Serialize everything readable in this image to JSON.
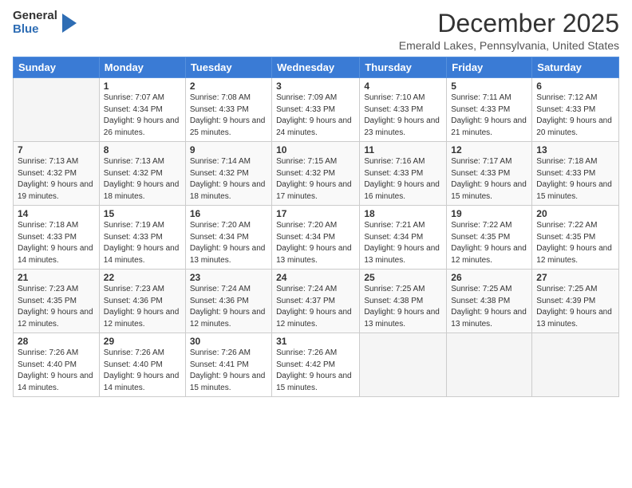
{
  "logo": {
    "general": "General",
    "blue": "Blue"
  },
  "title": "December 2025",
  "subtitle": "Emerald Lakes, Pennsylvania, United States",
  "days_of_week": [
    "Sunday",
    "Monday",
    "Tuesday",
    "Wednesday",
    "Thursday",
    "Friday",
    "Saturday"
  ],
  "weeks": [
    [
      {
        "num": "",
        "sunrise": "",
        "sunset": "",
        "daylight": ""
      },
      {
        "num": "1",
        "sunrise": "Sunrise: 7:07 AM",
        "sunset": "Sunset: 4:34 PM",
        "daylight": "Daylight: 9 hours and 26 minutes."
      },
      {
        "num": "2",
        "sunrise": "Sunrise: 7:08 AM",
        "sunset": "Sunset: 4:33 PM",
        "daylight": "Daylight: 9 hours and 25 minutes."
      },
      {
        "num": "3",
        "sunrise": "Sunrise: 7:09 AM",
        "sunset": "Sunset: 4:33 PM",
        "daylight": "Daylight: 9 hours and 24 minutes."
      },
      {
        "num": "4",
        "sunrise": "Sunrise: 7:10 AM",
        "sunset": "Sunset: 4:33 PM",
        "daylight": "Daylight: 9 hours and 23 minutes."
      },
      {
        "num": "5",
        "sunrise": "Sunrise: 7:11 AM",
        "sunset": "Sunset: 4:33 PM",
        "daylight": "Daylight: 9 hours and 21 minutes."
      },
      {
        "num": "6",
        "sunrise": "Sunrise: 7:12 AM",
        "sunset": "Sunset: 4:33 PM",
        "daylight": "Daylight: 9 hours and 20 minutes."
      }
    ],
    [
      {
        "num": "7",
        "sunrise": "Sunrise: 7:13 AM",
        "sunset": "Sunset: 4:32 PM",
        "daylight": "Daylight: 9 hours and 19 minutes."
      },
      {
        "num": "8",
        "sunrise": "Sunrise: 7:13 AM",
        "sunset": "Sunset: 4:32 PM",
        "daylight": "Daylight: 9 hours and 18 minutes."
      },
      {
        "num": "9",
        "sunrise": "Sunrise: 7:14 AM",
        "sunset": "Sunset: 4:32 PM",
        "daylight": "Daylight: 9 hours and 18 minutes."
      },
      {
        "num": "10",
        "sunrise": "Sunrise: 7:15 AM",
        "sunset": "Sunset: 4:32 PM",
        "daylight": "Daylight: 9 hours and 17 minutes."
      },
      {
        "num": "11",
        "sunrise": "Sunrise: 7:16 AM",
        "sunset": "Sunset: 4:33 PM",
        "daylight": "Daylight: 9 hours and 16 minutes."
      },
      {
        "num": "12",
        "sunrise": "Sunrise: 7:17 AM",
        "sunset": "Sunset: 4:33 PM",
        "daylight": "Daylight: 9 hours and 15 minutes."
      },
      {
        "num": "13",
        "sunrise": "Sunrise: 7:18 AM",
        "sunset": "Sunset: 4:33 PM",
        "daylight": "Daylight: 9 hours and 15 minutes."
      }
    ],
    [
      {
        "num": "14",
        "sunrise": "Sunrise: 7:18 AM",
        "sunset": "Sunset: 4:33 PM",
        "daylight": "Daylight: 9 hours and 14 minutes."
      },
      {
        "num": "15",
        "sunrise": "Sunrise: 7:19 AM",
        "sunset": "Sunset: 4:33 PM",
        "daylight": "Daylight: 9 hours and 14 minutes."
      },
      {
        "num": "16",
        "sunrise": "Sunrise: 7:20 AM",
        "sunset": "Sunset: 4:34 PM",
        "daylight": "Daylight: 9 hours and 13 minutes."
      },
      {
        "num": "17",
        "sunrise": "Sunrise: 7:20 AM",
        "sunset": "Sunset: 4:34 PM",
        "daylight": "Daylight: 9 hours and 13 minutes."
      },
      {
        "num": "18",
        "sunrise": "Sunrise: 7:21 AM",
        "sunset": "Sunset: 4:34 PM",
        "daylight": "Daylight: 9 hours and 13 minutes."
      },
      {
        "num": "19",
        "sunrise": "Sunrise: 7:22 AM",
        "sunset": "Sunset: 4:35 PM",
        "daylight": "Daylight: 9 hours and 12 minutes."
      },
      {
        "num": "20",
        "sunrise": "Sunrise: 7:22 AM",
        "sunset": "Sunset: 4:35 PM",
        "daylight": "Daylight: 9 hours and 12 minutes."
      }
    ],
    [
      {
        "num": "21",
        "sunrise": "Sunrise: 7:23 AM",
        "sunset": "Sunset: 4:35 PM",
        "daylight": "Daylight: 9 hours and 12 minutes."
      },
      {
        "num": "22",
        "sunrise": "Sunrise: 7:23 AM",
        "sunset": "Sunset: 4:36 PM",
        "daylight": "Daylight: 9 hours and 12 minutes."
      },
      {
        "num": "23",
        "sunrise": "Sunrise: 7:24 AM",
        "sunset": "Sunset: 4:36 PM",
        "daylight": "Daylight: 9 hours and 12 minutes."
      },
      {
        "num": "24",
        "sunrise": "Sunrise: 7:24 AM",
        "sunset": "Sunset: 4:37 PM",
        "daylight": "Daylight: 9 hours and 12 minutes."
      },
      {
        "num": "25",
        "sunrise": "Sunrise: 7:25 AM",
        "sunset": "Sunset: 4:38 PM",
        "daylight": "Daylight: 9 hours and 13 minutes."
      },
      {
        "num": "26",
        "sunrise": "Sunrise: 7:25 AM",
        "sunset": "Sunset: 4:38 PM",
        "daylight": "Daylight: 9 hours and 13 minutes."
      },
      {
        "num": "27",
        "sunrise": "Sunrise: 7:25 AM",
        "sunset": "Sunset: 4:39 PM",
        "daylight": "Daylight: 9 hours and 13 minutes."
      }
    ],
    [
      {
        "num": "28",
        "sunrise": "Sunrise: 7:26 AM",
        "sunset": "Sunset: 4:40 PM",
        "daylight": "Daylight: 9 hours and 14 minutes."
      },
      {
        "num": "29",
        "sunrise": "Sunrise: 7:26 AM",
        "sunset": "Sunset: 4:40 PM",
        "daylight": "Daylight: 9 hours and 14 minutes."
      },
      {
        "num": "30",
        "sunrise": "Sunrise: 7:26 AM",
        "sunset": "Sunset: 4:41 PM",
        "daylight": "Daylight: 9 hours and 15 minutes."
      },
      {
        "num": "31",
        "sunrise": "Sunrise: 7:26 AM",
        "sunset": "Sunset: 4:42 PM",
        "daylight": "Daylight: 9 hours and 15 minutes."
      },
      {
        "num": "",
        "sunrise": "",
        "sunset": "",
        "daylight": ""
      },
      {
        "num": "",
        "sunrise": "",
        "sunset": "",
        "daylight": ""
      },
      {
        "num": "",
        "sunrise": "",
        "sunset": "",
        "daylight": ""
      }
    ]
  ]
}
